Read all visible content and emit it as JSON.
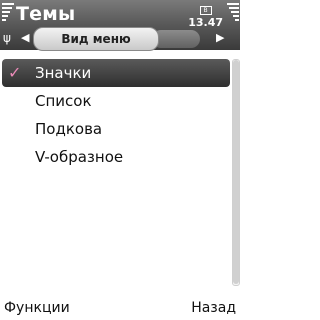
{
  "header": {
    "title": "Темы",
    "time": "13.47",
    "status_icon": "B",
    "tab_left_arrow": "◀",
    "tab_right_arrow": "▶",
    "tab_label": "Вид меню"
  },
  "list": {
    "items": [
      {
        "label": "Значки",
        "selected": true
      },
      {
        "label": "Список",
        "selected": false
      },
      {
        "label": "Подкова",
        "selected": false
      },
      {
        "label": "V-образное",
        "selected": false
      }
    ]
  },
  "softkeys": {
    "left": "Функции",
    "right": "Назад"
  },
  "colors": {
    "header_dark": "#3a3a3a",
    "selected_bg": "#2f2f2f",
    "check_pink": "#e98ab7"
  }
}
